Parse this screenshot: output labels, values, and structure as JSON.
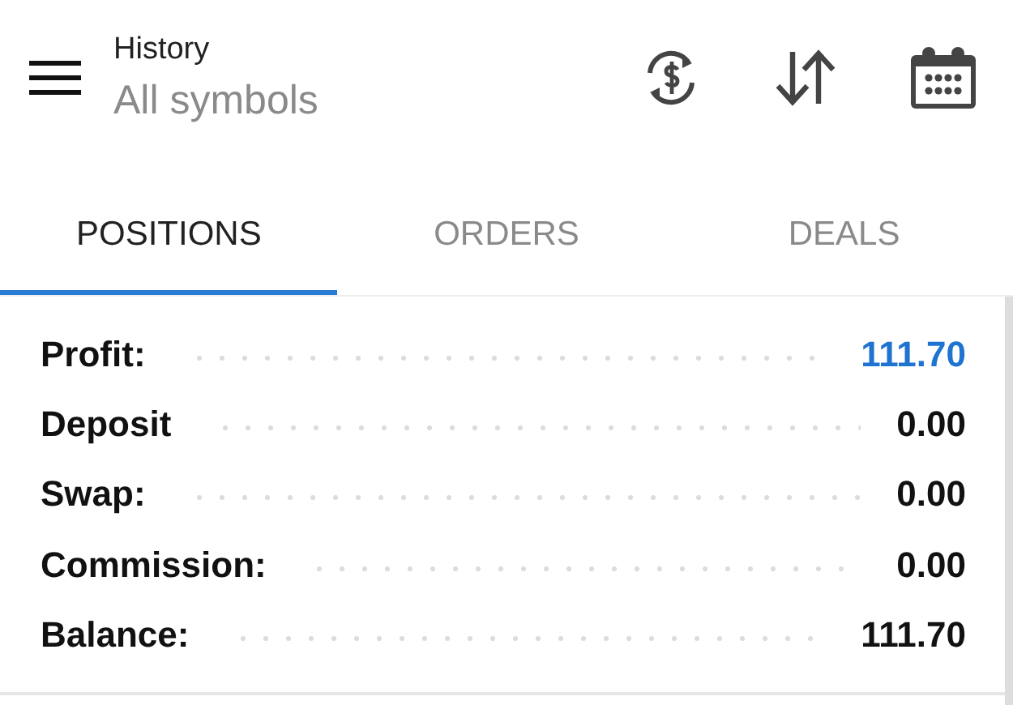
{
  "header": {
    "title": "History",
    "subtitle": "All symbols"
  },
  "tabs": [
    {
      "label": "POSITIONS",
      "selected": true
    },
    {
      "label": "ORDERS",
      "selected": false
    },
    {
      "label": "DEALS",
      "selected": false
    }
  ],
  "summary": [
    {
      "label": "Profit:",
      "value": "111.70",
      "color": "#1f73d1"
    },
    {
      "label": "Deposit",
      "value": "0.00",
      "color": "#111111"
    },
    {
      "label": "Swap:",
      "value": "0.00",
      "color": "#111111"
    },
    {
      "label": "Commission:",
      "value": "0.00",
      "color": "#111111"
    },
    {
      "label": "Balance:",
      "value": "111.70",
      "color": "#111111"
    }
  ]
}
